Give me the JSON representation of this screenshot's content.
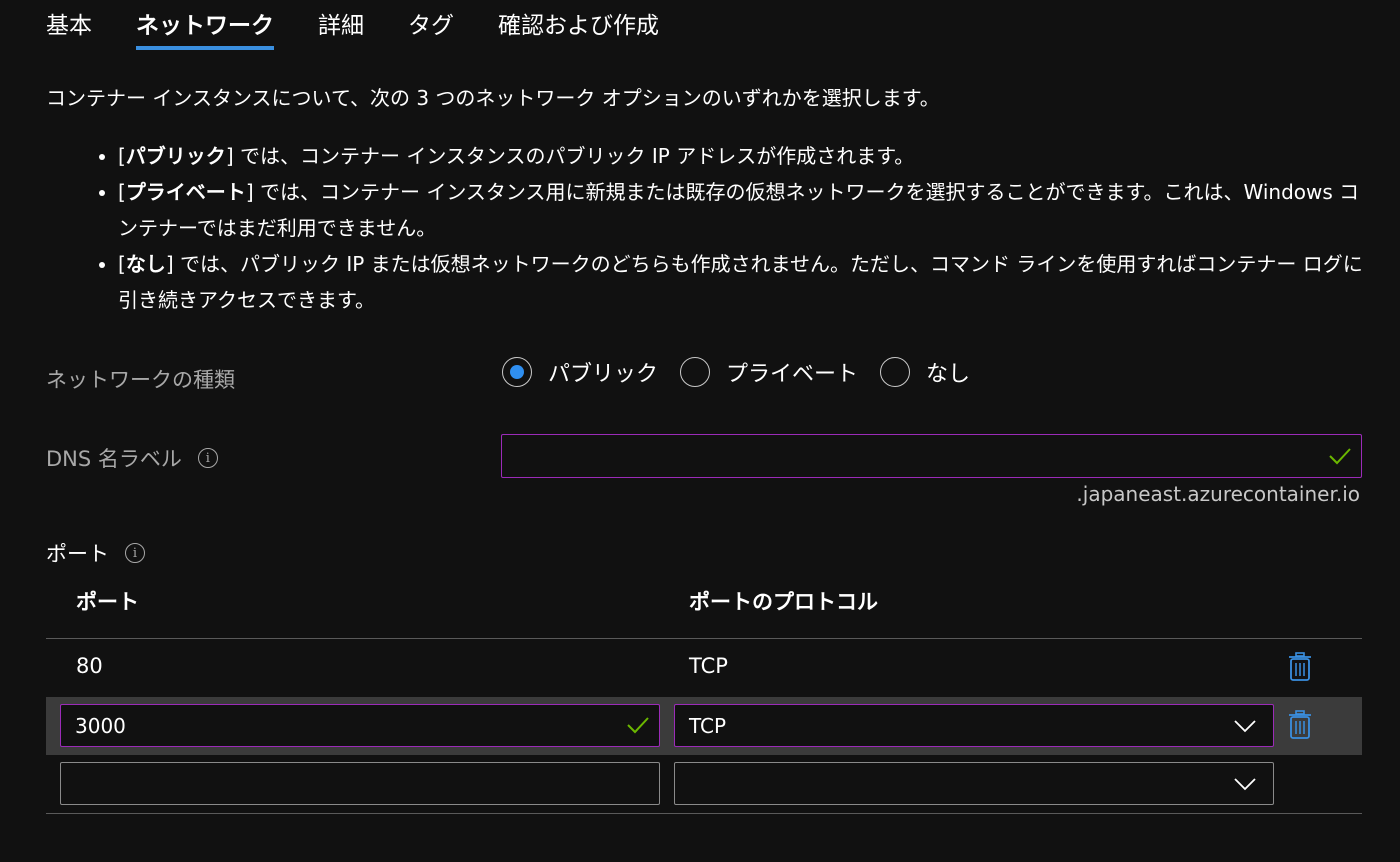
{
  "tabs": [
    {
      "label": "基本",
      "active": false
    },
    {
      "label": "ネットワーク",
      "active": true
    },
    {
      "label": "詳細",
      "active": false
    },
    {
      "label": "タグ",
      "active": false
    },
    {
      "label": "確認および作成",
      "active": false
    }
  ],
  "intro": "コンテナー インスタンスについて、次の 3 つのネットワーク オプションのいずれかを選択します。",
  "bullets": [
    {
      "open": "[",
      "bold": "パブリック",
      "rest": "] では、コンテナー インスタンスのパブリック IP アドレスが作成されます。"
    },
    {
      "open": "[",
      "bold": "プライベート",
      "rest": "] では、コンテナー インスタンス用に新規または既存の仮想ネットワークを選択することができます。これは、Windows コンテナーではまだ利用できません。"
    },
    {
      "open": "[",
      "bold": "なし",
      "rest": "] では、パブリック IP または仮想ネットワークのどちらも作成されません。ただし、コマンド ラインを使用すればコンテナー ログに引き続きアクセスできます。"
    }
  ],
  "network_type": {
    "label": "ネットワークの種類",
    "options": [
      "パブリック",
      "プライベート",
      "なし"
    ],
    "selected": "パブリック"
  },
  "dns": {
    "label": "DNS 名ラベル",
    "value": "",
    "suffix": ".japaneast.azurecontainer.io"
  },
  "ports": {
    "section_label": "ポート",
    "columns": [
      "ポート",
      "ポートのプロトコル"
    ],
    "rows": [
      {
        "port": "80",
        "protocol": "TCP"
      },
      {
        "port": "3000",
        "protocol": "TCP"
      },
      {
        "port": "",
        "protocol": ""
      }
    ]
  },
  "colors": {
    "accent": "#3a8fe0",
    "focus_border": "#9b2bb8",
    "valid_check": "#6bb700",
    "delete_icon": "#3a8fe0",
    "background": "#111111"
  }
}
